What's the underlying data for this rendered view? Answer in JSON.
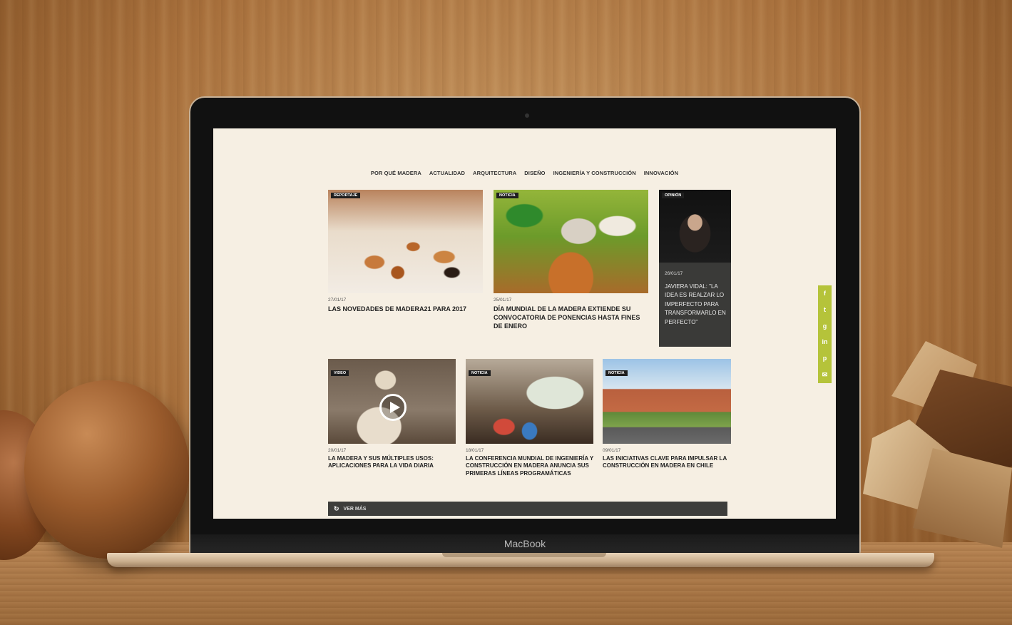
{
  "device": {
    "brand_label": "MacBook"
  },
  "nav": {
    "items": [
      "POR QUÉ MADERA",
      "ACTUALIDAD",
      "ARQUITECTURA",
      "DISEÑO",
      "INGENIERÍA Y CONSTRUCCIÓN",
      "INNOVACIÓN"
    ]
  },
  "featured": [
    {
      "tag": "REPORTAJE",
      "date": "27/01/17",
      "title": "LAS NOVEDADES DE MADERA21 PARA 2017"
    },
    {
      "tag": "NOTICIA",
      "date": "25/01/17",
      "title": "DÍA MUNDIAL DE LA MADERA EXTIENDE SU CONVOCATORIA DE PONENCIAS HASTA FINES DE ENERO"
    }
  ],
  "opinion": {
    "tag": "OPINIÓN",
    "date": "26/01/17",
    "title": "JAVIERA VIDAL: \"LA IDEA ES REALZAR LO IMPERFECTO PARA TRANSFORMARLO EN PERFECTO\""
  },
  "grid": [
    {
      "tag": "VIDEO",
      "date": "20/01/17",
      "title": "LA MADERA Y SUS MÚLTIPLES USOS: APLICACIONES PARA LA VIDA DIARIA"
    },
    {
      "tag": "NOTICIA",
      "date": "18/01/17",
      "title": "LA CONFERENCIA MUNDIAL DE INGENIERÍA Y CONSTRUCCIÓN EN MADERA ANUNCIA SUS PRIMERAS LÍNEAS PROGRAMÁTICAS"
    },
    {
      "tag": "NOTICIA",
      "date": "09/01/17",
      "title": "LAS INICIATIVAS CLAVE PARA IMPULSAR LA CONSTRUCCIÓN EN MADERA EN CHILE"
    }
  ],
  "share": {
    "icons": [
      "facebook-icon",
      "twitter-icon",
      "google-plus-icon",
      "linkedin-icon",
      "pinterest-icon",
      "email-icon"
    ],
    "glyphs": [
      "f",
      "t",
      "g",
      "in",
      "p",
      "✉"
    ],
    "color": "#b5c33a"
  },
  "more": {
    "label": "VER MÁS"
  }
}
